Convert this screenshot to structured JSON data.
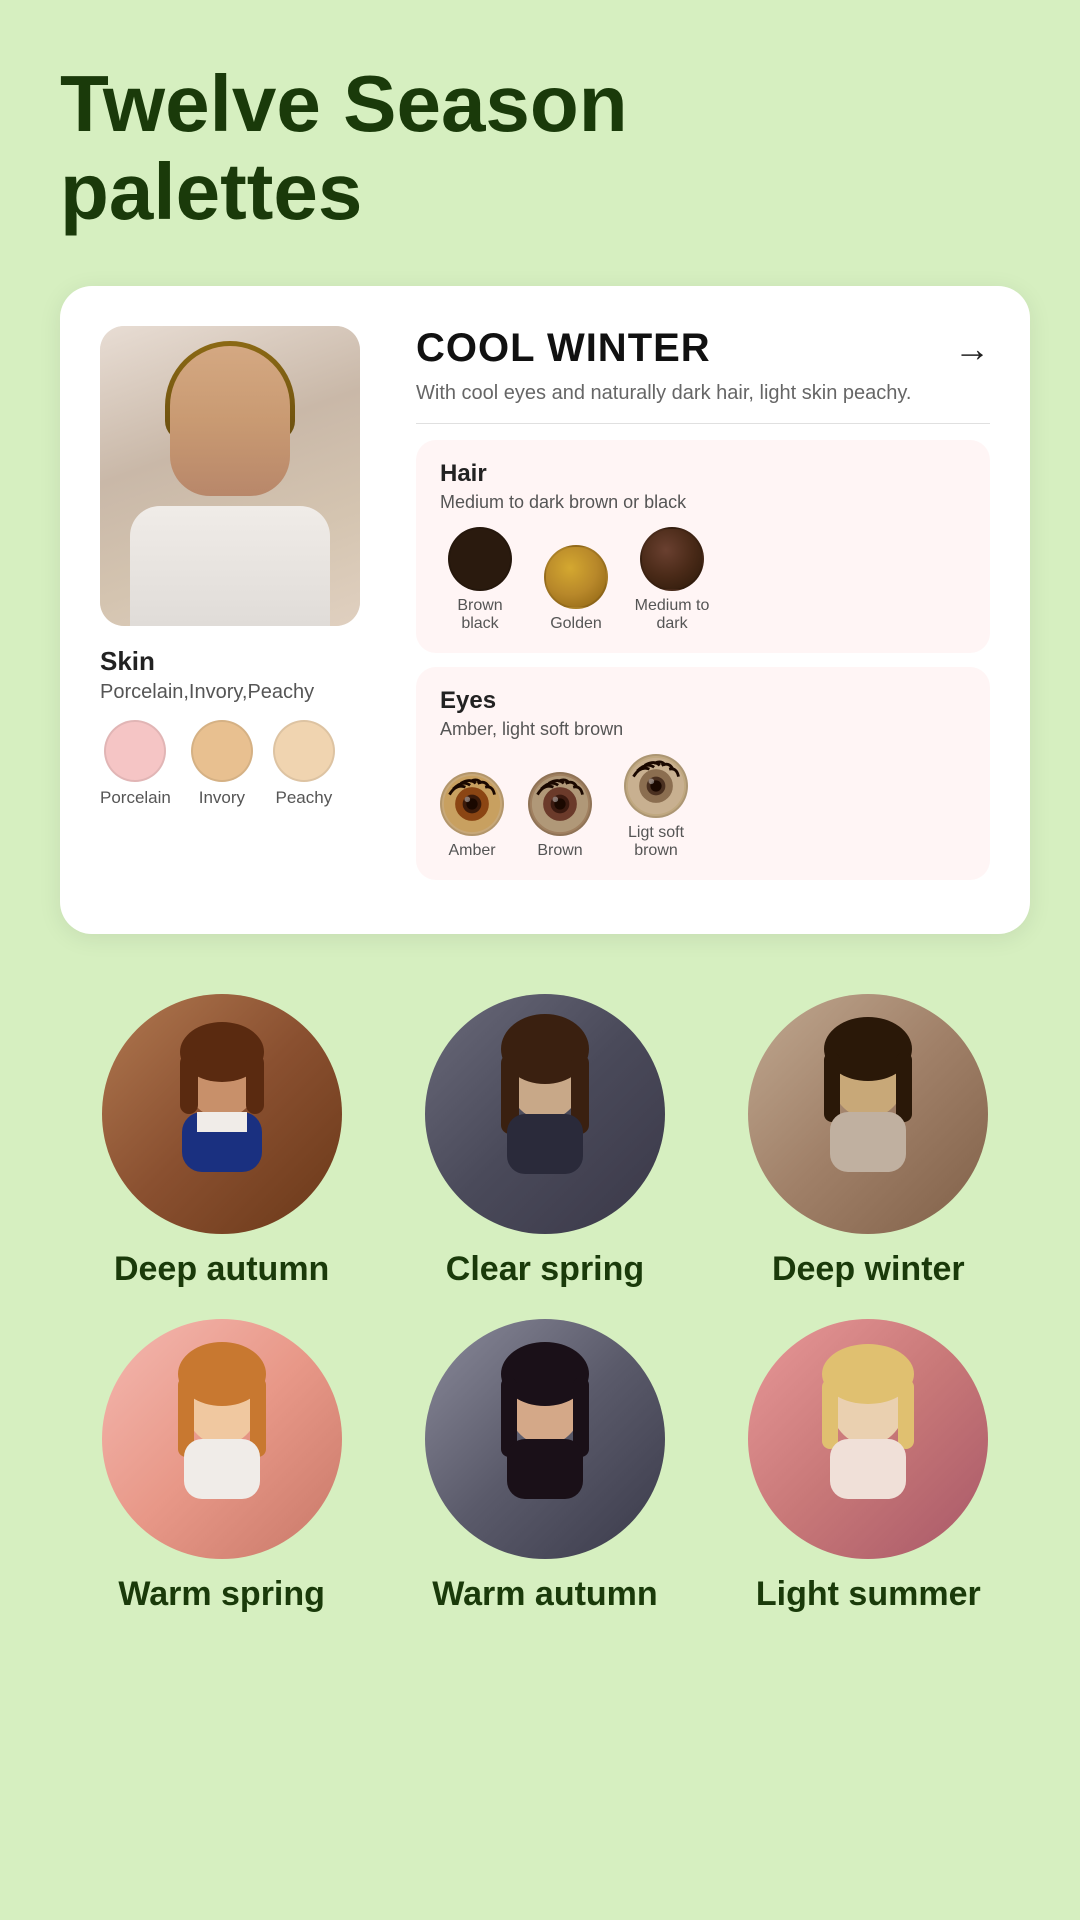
{
  "page": {
    "title_line1": "Twelve Season",
    "title_line2": "palettes"
  },
  "card": {
    "season": "COOL WINTER",
    "arrow": "→",
    "description": "With cool eyes and naturally dark hair, light skin peachy.",
    "skin_label": "Skin",
    "skin_sub": "Porcelain,Invory,Peachy",
    "skin_swatches": [
      {
        "color": "#f5c5c5",
        "name": "Porcelain"
      },
      {
        "color": "#e8c090",
        "name": "Invory"
      },
      {
        "color": "#f0d4b0",
        "name": "Peachy"
      }
    ],
    "hair": {
      "title": "Hair",
      "subtitle": "Medium to dark brown or black",
      "swatches": [
        {
          "color": "#2a1a0e",
          "name": "Brown black"
        },
        {
          "color": "#b8882a",
          "name": "Golden"
        },
        {
          "color": "#4a2a18",
          "name": "Medium\nto dark"
        }
      ]
    },
    "eyes": {
      "title": "Eyes",
      "subtitle": "Amber, light soft brown",
      "swatches": [
        {
          "iris_color": "#8B4513",
          "name": "Amber"
        },
        {
          "iris_color": "#6B3A2A",
          "name": "Brown"
        },
        {
          "iris_color": "#8B6E50",
          "name": "Ligt soft\nbrown"
        }
      ]
    }
  },
  "portraits_row1": [
    {
      "label": "Deep autumn",
      "bg": "bg-autumn1"
    },
    {
      "label": "Clear spring",
      "bg": "bg-spring1"
    },
    {
      "label": "Deep winter",
      "bg": "bg-winter1"
    }
  ],
  "portraits_row2": [
    {
      "label": "Warm spring",
      "bg": "bg-spring2"
    },
    {
      "label": "Warm autumn",
      "bg": "bg-autumn2"
    },
    {
      "label": "Light summer",
      "bg": "bg-summer1"
    }
  ]
}
